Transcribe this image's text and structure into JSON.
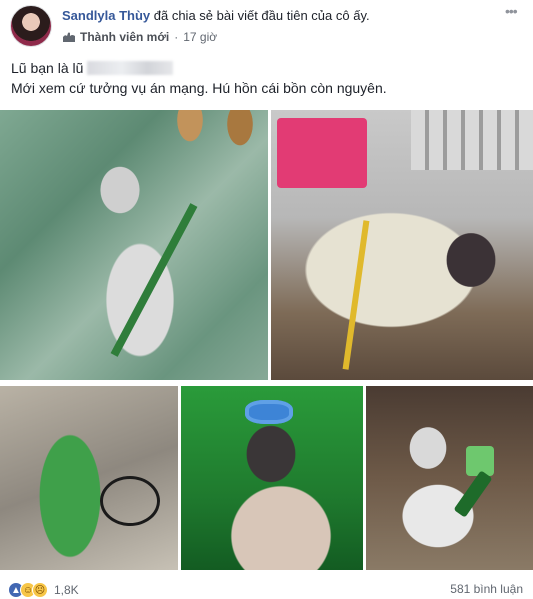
{
  "header": {
    "author": "Sandlyla Thùy",
    "action_text": " đã chia sẻ bài viết đầu tiên của cô ấy.",
    "badge": "Thành viên mới",
    "separator": "·",
    "time": "17 giờ",
    "more_icon": "more-dots-icon"
  },
  "post": {
    "line1": "Lũ bạn là lũ",
    "line2": "Mới xem cứ tưởng vụ án mạng. Hú hồn cái bồn còn nguyên."
  },
  "photos": [
    {
      "name": "photo-1"
    },
    {
      "name": "photo-2"
    },
    {
      "name": "photo-3"
    },
    {
      "name": "photo-4"
    },
    {
      "name": "photo-5"
    }
  ],
  "footer": {
    "reaction_icons": [
      "like-icon",
      "haha-icon",
      "sad-icon"
    ],
    "reaction_count": "1,8K",
    "comments": "581 bình luận"
  },
  "colors": {
    "author_link": "#365899",
    "meta_text": "#616770",
    "like_blue": "#4267b2",
    "emoji_yellow": "#f7c648"
  }
}
